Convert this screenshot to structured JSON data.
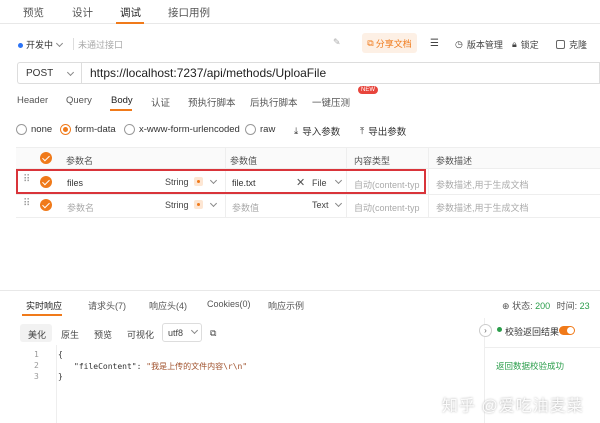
{
  "top_tabs": [
    "预览",
    "设计",
    "调试",
    "接口用例"
  ],
  "toolbar": {
    "env": "开发中",
    "name_placeholder": "未通过接口",
    "share": "分享文档",
    "version": "版本管理",
    "lock": "锁定",
    "clone": "克隆"
  },
  "request": {
    "method": "POST",
    "url": "https://localhost:7237/api/methods/UploaFile"
  },
  "sub_tabs": [
    "Header",
    "Query",
    "Body",
    "认证",
    "预执行脚本",
    "后执行脚本",
    "一键压测"
  ],
  "new_badge": "NEW",
  "body_types": [
    "none",
    "form-data",
    "x-www-form-urlencoded",
    "raw"
  ],
  "body_actions": {
    "import": "导入参数",
    "export": "导出参数"
  },
  "table": {
    "headers": [
      "参数名",
      "参数值",
      "内容类型",
      "参数描述"
    ],
    "rows": [
      {
        "name": "files",
        "type": "String",
        "value": "file.txt",
        "value_type": "File",
        "content_type": "自动(content-typ",
        "desc": "参数描述,用于生成文档"
      },
      {
        "name": "参数名",
        "type": "String",
        "value": "参数值",
        "value_type": "Text",
        "content_type": "自动(content-typ",
        "desc": "参数描述,用于生成文档"
      }
    ]
  },
  "response": {
    "tabs": [
      "实时响应",
      "请求头(7)",
      "响应头(4)",
      "Cookies(0)",
      "响应示例"
    ],
    "status_label": "状态:",
    "status_code": "200",
    "time_label": "时间:",
    "time_value": "23",
    "format_tabs": [
      "美化",
      "原生",
      "预览",
      "可视化"
    ],
    "encoding": "utf8",
    "code_lines": [
      {
        "n": "1",
        "text": "{"
      },
      {
        "n": "2",
        "key": "\"fileContent\"",
        "sep": ": ",
        "val": "\"我是上传的文件内容\\r\\n\""
      },
      {
        "n": "3",
        "text": "}"
      }
    ],
    "validate_label": "校验返回结果",
    "validate_success": "返回数据校验成功"
  },
  "watermark": "知乎 @爱吃油麦菜",
  "colors": {
    "accent": "#f07a1a",
    "highlight": "#d9343a",
    "success": "#2a9d4a"
  }
}
